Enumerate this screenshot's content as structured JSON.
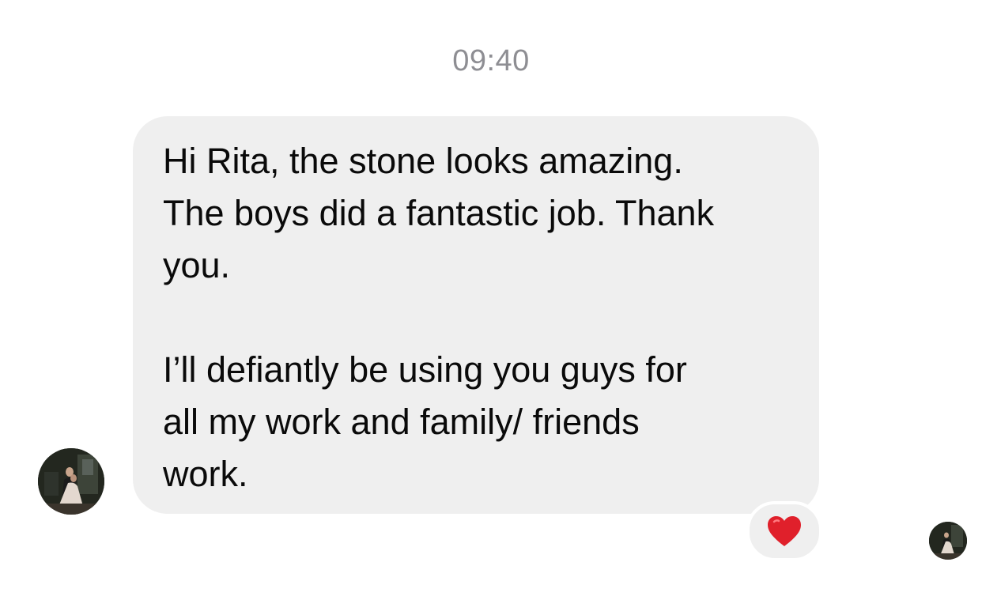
{
  "conversation": {
    "timestamp": "09:40",
    "incoming_message": {
      "paragraph_1": "Hi Rita, the stone looks amazing.\nThe boys did a fantastic job. Thank\nyou.",
      "paragraph_2": "I’ll defiantly be using you guys for\nall my work and family/ friends\nwork.",
      "reaction": "heart"
    }
  },
  "colors": {
    "bubble": "#efefef",
    "timestamp": "#8e8e93",
    "text": "#0a0a0a",
    "heart": "#e0202b"
  },
  "icons": {
    "reaction_icon": "red-heart-icon",
    "sender_avatar": "avatar",
    "read_receipt_avatar": "avatar"
  }
}
